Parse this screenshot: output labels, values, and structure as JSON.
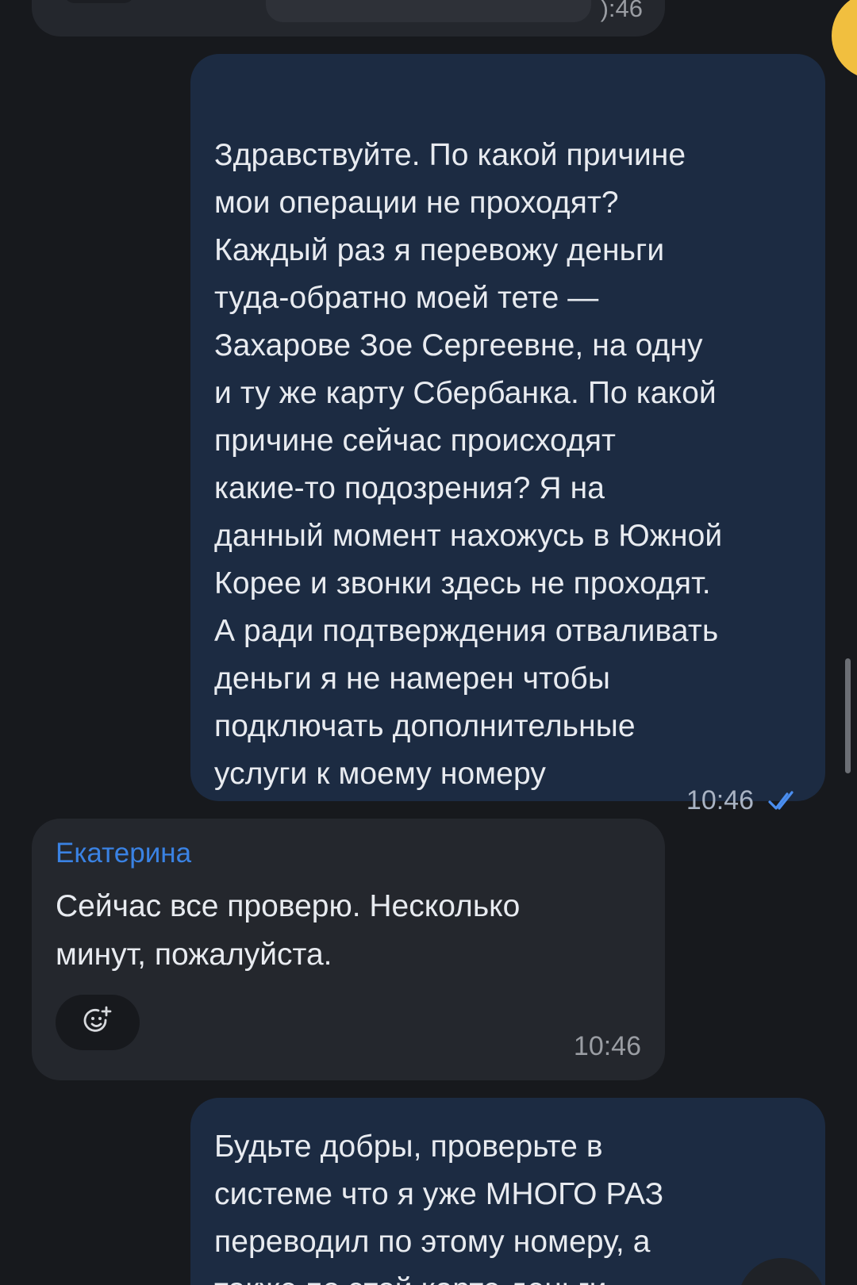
{
  "chat": {
    "top_cut_message": {
      "time": "):46"
    },
    "messages": [
      {
        "text": "Здравствуйте. По какой причине\nмои операции не проходят?\nКаждый раз я перевожу деньги\nтуда-обратно моей тете —\nЗахарове Зое Сергеевне, на одну\nи ту же карту Сбербанка. По какой\nпричине сейчас происходят\nкакие-то подозрения? Я на\nданный момент нахожусь в Южной\nКорее и звонки здесь не проходят.\nА ради подтверждения отваливать\nденьги я не намерен чтобы\nподключать дополнительные\nуслуги к моему номеру",
        "time": "10:46"
      },
      {
        "sender": "Екатерина",
        "text": "Сейчас все проверю. Несколько\nминут, пожалуйста.",
        "time": "10:46"
      },
      {
        "text": "Будьте добры, проверьте в\nсистеме что я уже МНОГО РАЗ\nпереводил по этому номеру, а\nтакже по этой карте деньги"
      }
    ]
  },
  "icons": {
    "read_status": "double-check-icon",
    "reaction": "add-reaction-icon"
  },
  "colors": {
    "background": "#17191d",
    "outgoing_bubble": "#1c2b42",
    "incoming_bubble": "#24272d",
    "sender_name": "#3a82e3",
    "read_check": "#4a8ef0",
    "avatar": "#f1bf3f"
  }
}
